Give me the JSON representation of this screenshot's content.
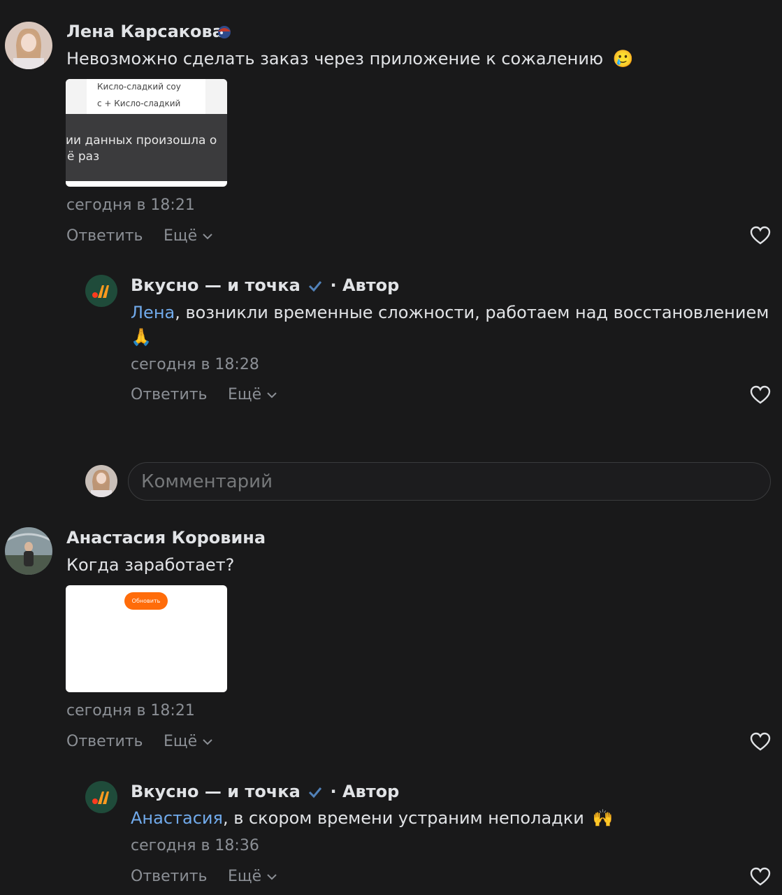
{
  "comments": [
    {
      "author": "Лена Карсакова",
      "text": "Невозможно сделать заказ через приложение к сожалению",
      "emoji": "🥲",
      "image": {
        "line1": "Кисло-сладкий соу",
        "line2": "с + Кисло-сладкий",
        "line3": "ии данных произошла о",
        "line4": "ё раз"
      },
      "time": "сегодня в 18:21",
      "reply_label": "Ответить",
      "more_label": "Ещё",
      "reply": {
        "author": "Вкусно — и точка",
        "author_suffix": "· Автор",
        "mention": "Лена",
        "text": ", возникли временные сложности, работаем над восстановлением",
        "emoji": "🙏",
        "time": "сегодня в 18:28",
        "reply_label": "Ответить",
        "more_label": "Ещё"
      }
    },
    {
      "author": "Анастасия Коровина",
      "text": "Когда заработает?",
      "image": {
        "button": "Обновить"
      },
      "time": "сегодня в 18:21",
      "reply_label": "Ответить",
      "more_label": "Ещё",
      "reply": {
        "author": "Вкусно — и точка",
        "author_suffix": "· Автор",
        "mention": "Анастасия",
        "text": ", в скором времени устраним неполадки",
        "emoji": "🙌",
        "time": "сегодня в 18:36",
        "reply_label": "Ответить",
        "more_label": "Ещё"
      }
    }
  ],
  "comment_input": {
    "placeholder": "Комментарий"
  },
  "colors": {
    "accent": "#71aaeb",
    "verified": "#5181b8",
    "brand_orange": "#ff6c0a",
    "brand_green": "#1f4b3a"
  }
}
